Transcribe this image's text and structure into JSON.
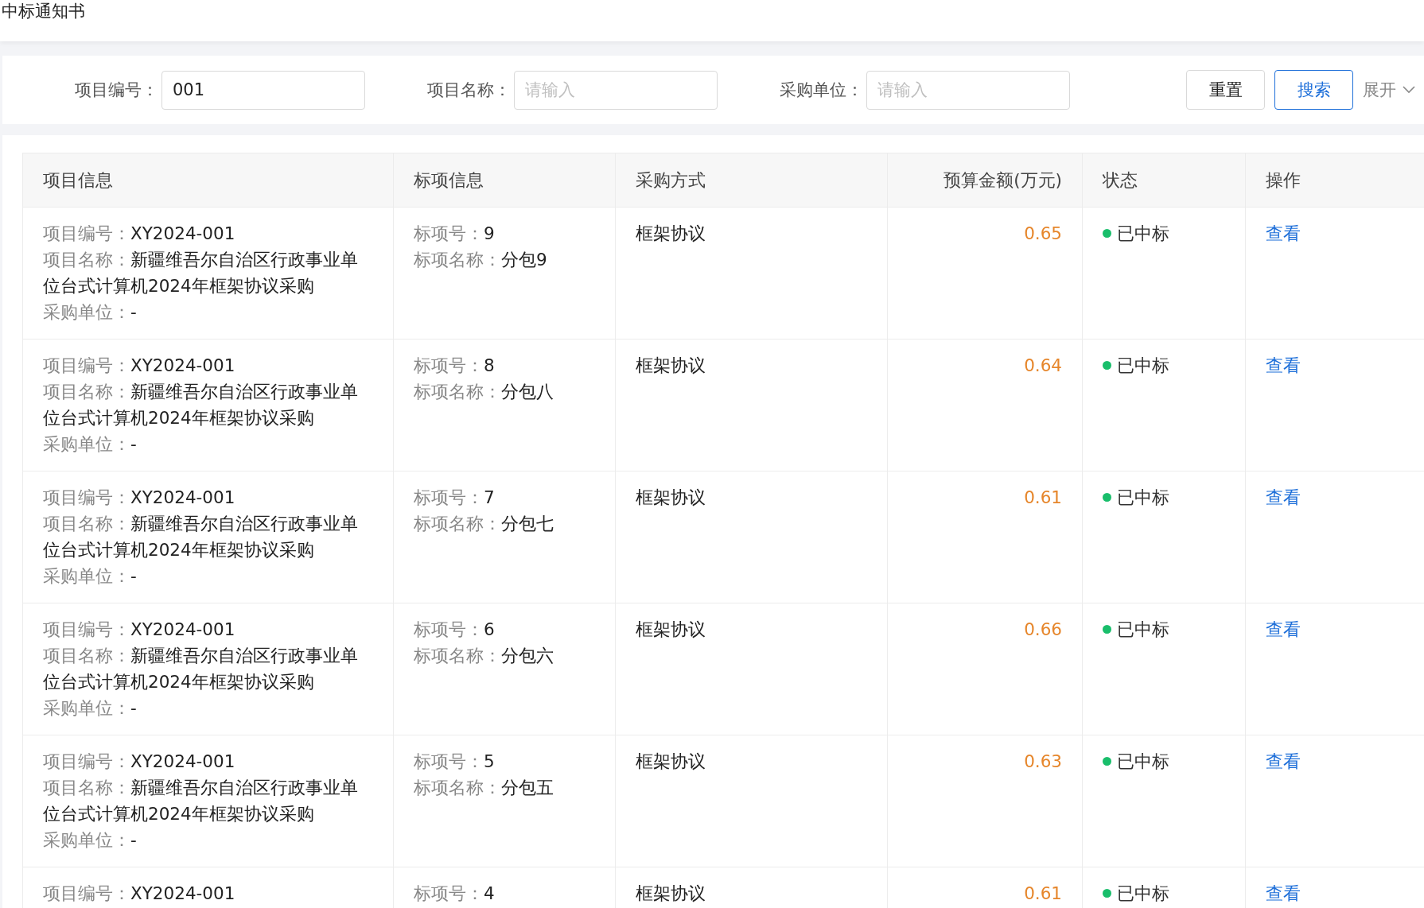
{
  "page_title": "中标通知书",
  "filters": [
    {
      "label": "项目编号：",
      "value": "001"
    },
    {
      "label": "项目名称：",
      "placeholder": "请输入"
    },
    {
      "label": "采购单位：",
      "placeholder": "请输入"
    }
  ],
  "buttons": {
    "reset": "重置",
    "search": "搜索",
    "expand": "展开"
  },
  "table": {
    "columns": [
      "项目信息",
      "标项信息",
      "采购方式",
      "预算金额(万元)",
      "状态",
      "操作"
    ],
    "rows": [
      {
        "project_no_label": "项目编号：",
        "project_no": "XY2024-001",
        "project_name_label": "项目名称：",
        "project_name": "新疆维吾尔自治区行政事业单位台式计算机2024年框架协议采购",
        "buyer_label": "采购单位：",
        "buyer": "-",
        "lot_no_label": "标项号：",
        "lot_no": "9",
        "lot_name_label": "标项名称：",
        "lot_name": "分包9",
        "method": "框架协议",
        "budget": "0.65",
        "status": "已中标",
        "color": "#19be6b",
        "action": "查看"
      },
      {
        "project_no_label": "项目编号：",
        "project_no": "XY2024-001",
        "project_name_label": "项目名称：",
        "project_name": "新疆维吾尔自治区行政事业单位台式计算机2024年框架协议采购",
        "buyer_label": "采购单位：",
        "buyer": "-",
        "lot_no_label": "标项号：",
        "lot_no": "8",
        "lot_name_label": "标项名称：",
        "lot_name": "分包八",
        "method": "框架协议",
        "budget": "0.64",
        "status": "已中标",
        "color": "#19be6b",
        "action": "查看"
      },
      {
        "project_no_label": "项目编号：",
        "project_no": "XY2024-001",
        "project_name_label": "项目名称：",
        "project_name": "新疆维吾尔自治区行政事业单位台式计算机2024年框架协议采购",
        "buyer_label": "采购单位：",
        "buyer": "-",
        "lot_no_label": "标项号：",
        "lot_no": "7",
        "lot_name_label": "标项名称：",
        "lot_name": "分包七",
        "method": "框架协议",
        "budget": "0.61",
        "status": "已中标",
        "color": "#19be6b",
        "action": "查看"
      },
      {
        "project_no_label": "项目编号：",
        "project_no": "XY2024-001",
        "project_name_label": "项目名称：",
        "project_name": "新疆维吾尔自治区行政事业单位台式计算机2024年框架协议采购",
        "buyer_label": "采购单位：",
        "buyer": "-",
        "lot_no_label": "标项号：",
        "lot_no": "6",
        "lot_name_label": "标项名称：",
        "lot_name": "分包六",
        "method": "框架协议",
        "budget": "0.66",
        "status": "已中标",
        "color": "#19be6b",
        "action": "查看"
      },
      {
        "project_no_label": "项目编号：",
        "project_no": "XY2024-001",
        "project_name_label": "项目名称：",
        "project_name": "新疆维吾尔自治区行政事业单位台式计算机2024年框架协议采购",
        "buyer_label": "采购单位：",
        "buyer": "-",
        "lot_no_label": "标项号：",
        "lot_no": "5",
        "lot_name_label": "标项名称：",
        "lot_name": "分包五",
        "method": "框架协议",
        "budget": "0.63",
        "status": "已中标",
        "color": "#19be6b",
        "action": "查看"
      },
      {
        "project_no_label": "项目编号：",
        "project_no": "XY2024-001",
        "lot_no_label": "标项号：",
        "lot_no": "4",
        "method": "框架协议",
        "budget": "0.61",
        "status": "已中标",
        "color": "#19be6b",
        "action": "查看"
      }
    ]
  }
}
